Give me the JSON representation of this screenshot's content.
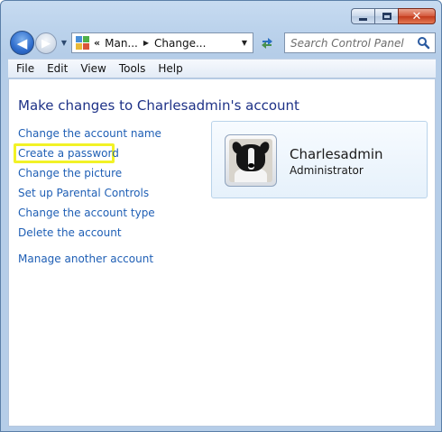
{
  "window": {
    "caption_buttons": {
      "minimize": "minimize-icon",
      "maximize": "maximize-icon",
      "close": "close-icon"
    }
  },
  "nav": {
    "address": {
      "overflow": "«",
      "crumbs": [
        "Man...",
        "Change..."
      ]
    },
    "search": {
      "placeholder": "Search Control Panel"
    }
  },
  "menu": {
    "items": [
      "File",
      "Edit",
      "View",
      "Tools",
      "Help"
    ]
  },
  "main": {
    "title": "Make changes to Charlesadmin's account",
    "tasks": [
      "Change the account name",
      "Create a password",
      "Change the picture",
      "Set up Parental Controls",
      "Change the account type",
      "Delete the account"
    ],
    "other_task": "Manage another account",
    "highlighted_task_index": 1,
    "highlight_color": "#f2f226",
    "link_color": "#1f5fb5",
    "title_color": "#1e3287"
  },
  "account": {
    "name": "Charlesadmin",
    "role": "Administrator",
    "avatar_icon": "border-collie-avatar"
  }
}
